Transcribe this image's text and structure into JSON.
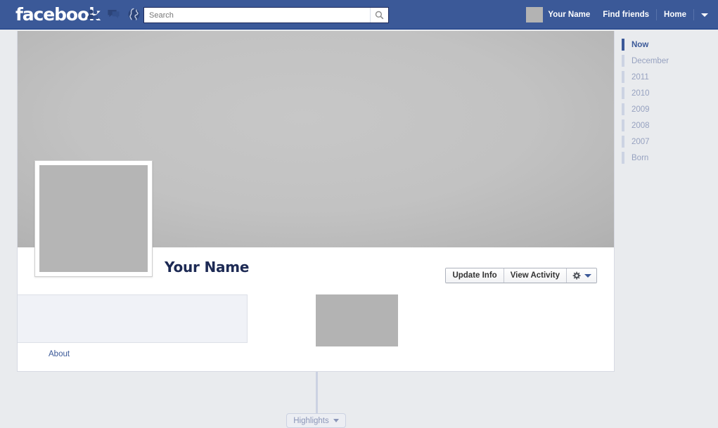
{
  "topbar": {
    "logo": "facebook",
    "icons": [
      {
        "name": "friend-requests-icon",
        "glyph": "friends"
      },
      {
        "name": "messages-icon",
        "glyph": "messages"
      },
      {
        "name": "notifications-icon",
        "glyph": "globe"
      }
    ],
    "search": {
      "placeholder": "Search",
      "value": "",
      "button_icon": "search-icon"
    },
    "user_name": "Your Name",
    "find_friends": "Find friends",
    "home": "Home",
    "account_caret": "▼",
    "bar_color": "#3b5998"
  },
  "profile": {
    "name": "Your Name",
    "buttons": {
      "update_info": "Update Info",
      "view_activity": "View Activity",
      "gear_icon": "gear-icon",
      "gear_caret": "chevron-down-icon"
    },
    "about_link": "About"
  },
  "timeline_nav": {
    "items": [
      {
        "label": "Now",
        "active": true
      },
      {
        "label": "December",
        "active": false
      },
      {
        "label": "2011",
        "active": false
      },
      {
        "label": "2010",
        "active": false
      },
      {
        "label": "2009",
        "active": false
      },
      {
        "label": "2008",
        "active": false
      },
      {
        "label": "2007",
        "active": false
      },
      {
        "label": "Born",
        "active": false
      }
    ],
    "active_color": "#3b5998",
    "inactive_color": "#97a2c0"
  },
  "highlights": {
    "label": "Highlights",
    "caret": "chevron-down-icon"
  },
  "colors": {
    "page_background": "#e9ebee",
    "card_background": "#ffffff",
    "brand": "#3b5998",
    "name_color": "#1d2a54",
    "placeholder_gray": "#b3b3b3"
  }
}
